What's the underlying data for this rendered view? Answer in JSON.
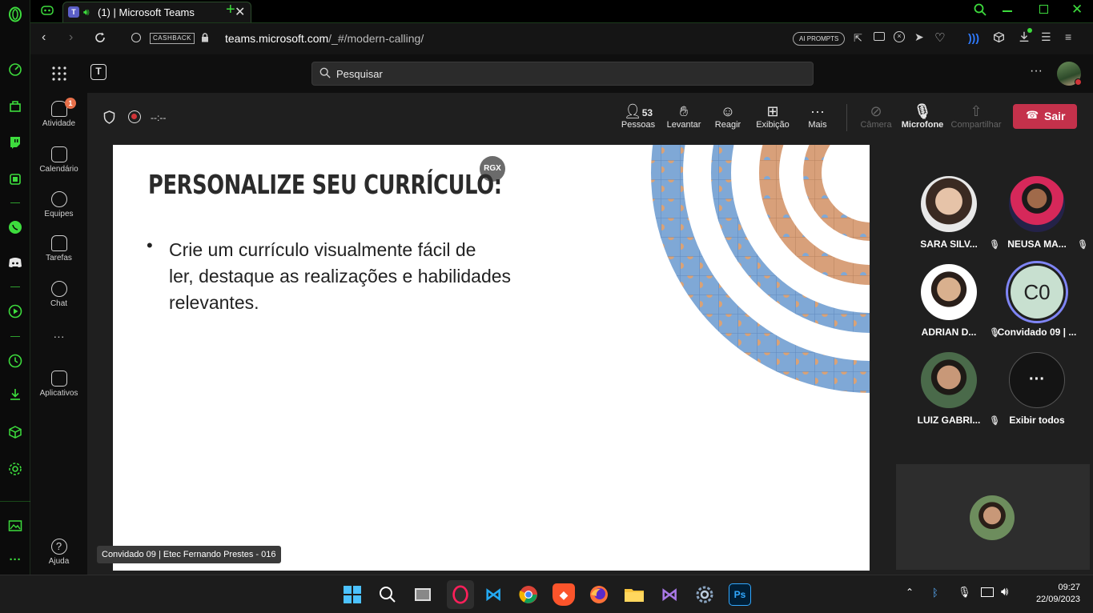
{
  "browser": {
    "tab_title": "(1) | Microsoft Teams",
    "new_tab": "+",
    "url_domain": "teams.microsoft.com",
    "url_path": "/_#/modern-calling/",
    "cashback": "CASHBACK",
    "ai_prompts": "AI PROMPTS"
  },
  "teams": {
    "search_placeholder": "Pesquisar",
    "more": "···",
    "rail": [
      {
        "label": "Atividade",
        "badge": "1"
      },
      {
        "label": "Calendário"
      },
      {
        "label": "Equipes"
      },
      {
        "label": "Tarefas"
      },
      {
        "label": "Chat"
      },
      {
        "label": "···"
      },
      {
        "label": "Aplicativos"
      },
      {
        "label": "Ajuda"
      }
    ]
  },
  "meeting": {
    "timer": "--:--",
    "people_count": "53",
    "buttons": {
      "people": "Pessoas",
      "raise": "Levantar",
      "react": "Reagir",
      "view": "Exibição",
      "more": "Mais",
      "camera": "Câmera",
      "mic": "Microfone",
      "share": "Compartilhar",
      "leave": "Sair"
    }
  },
  "slide": {
    "title": "PERSONALIZE SEU CURRÍCULO:",
    "badge": "RGX",
    "bullet_line1": "Crie um currículo visualmente fácil de",
    "bullet_line2": "ler, destaque as realizações e habilidades",
    "bullet_line3": "relevantes.",
    "presenter": "Convidado 09 | Etec Fernando Prestes - 016"
  },
  "participants": [
    {
      "name": "SARA SILV..."
    },
    {
      "name": "NEUSA MA..."
    },
    {
      "name": "ADRIAN D..."
    },
    {
      "name": "Convidado 09 | ...",
      "initials": "C0"
    },
    {
      "name": "LUIZ GABRI..."
    },
    {
      "name": "Exibir todos"
    }
  ],
  "taskbar": {
    "time": "09:27",
    "date": "22/09/2023"
  }
}
